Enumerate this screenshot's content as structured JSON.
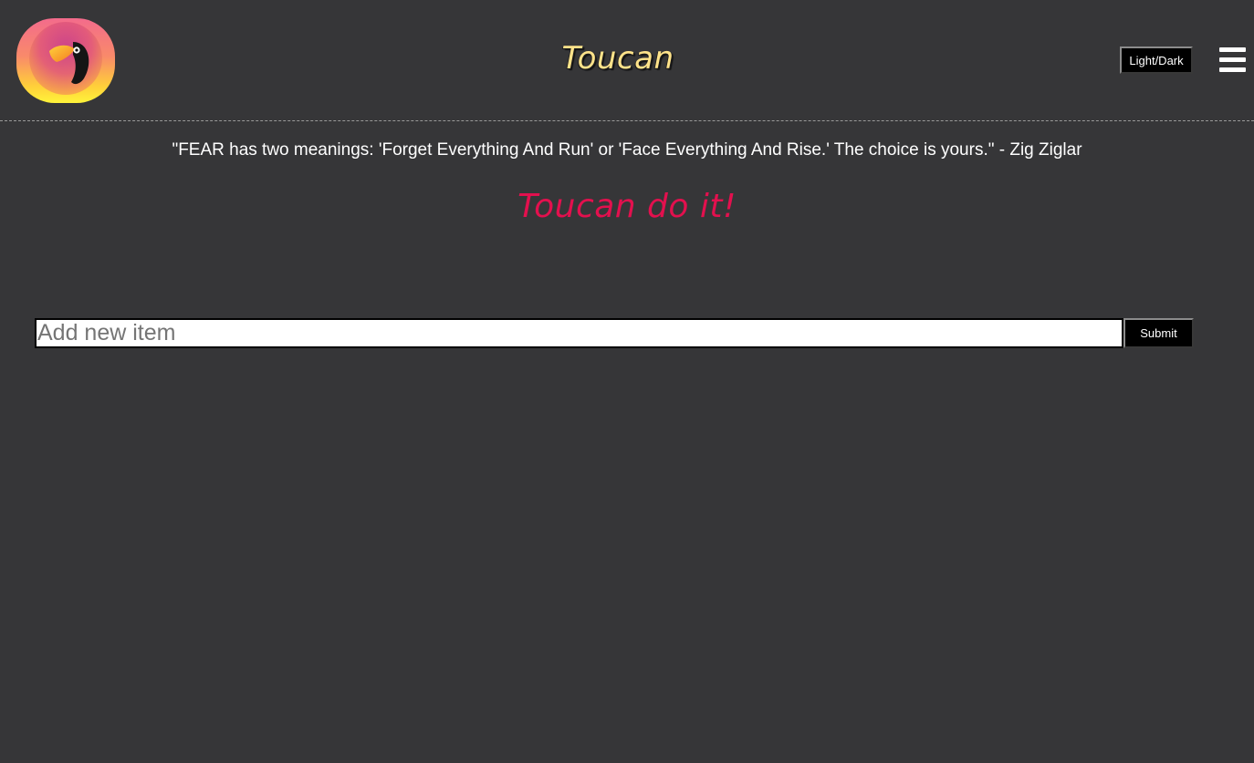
{
  "header": {
    "logo_icon": "toucan-logo-icon",
    "title": "Toucan",
    "theme_toggle_label": "Light/Dark",
    "menu_icon": "hamburger-menu-icon"
  },
  "main": {
    "quote": "\"FEAR has two meanings: 'Forget Everything And Run' or 'Face Everything And Rise.' The choice is yours.\" - Zig Ziglar",
    "tagline": "Toucan do it!",
    "add_item": {
      "placeholder": "Add new item",
      "value": "",
      "submit_label": "Submit"
    }
  },
  "colors": {
    "background": "#363638",
    "title": "#ffe38a",
    "tagline": "#e3104e",
    "logo_gradient_top": "#f36b8c",
    "logo_gradient_bottom": "#fff43a"
  }
}
